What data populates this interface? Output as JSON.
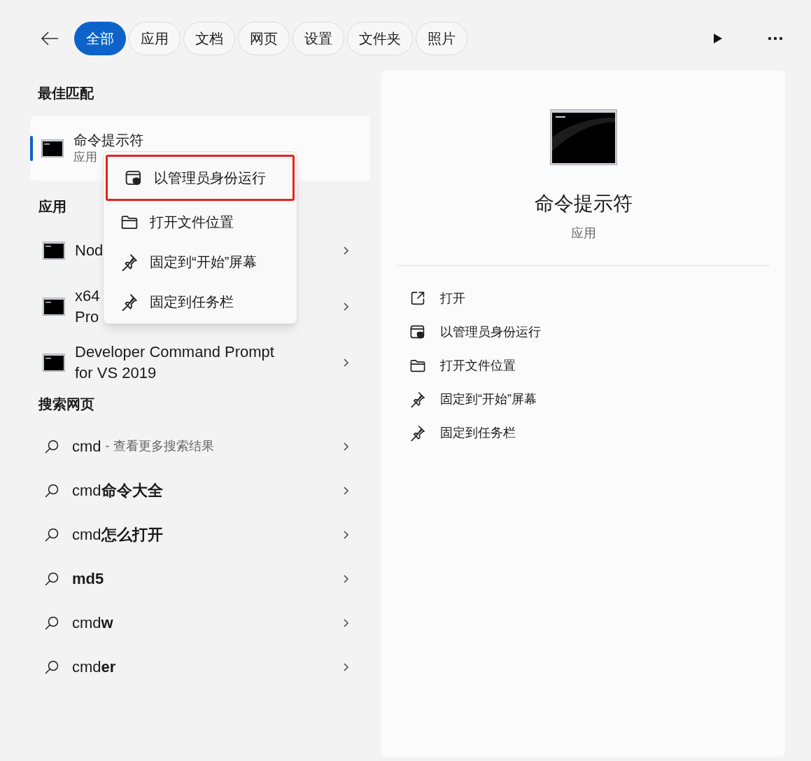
{
  "filter_tabs": [
    {
      "label": "全部",
      "selected": true
    },
    {
      "label": "应用",
      "selected": false
    },
    {
      "label": "文档",
      "selected": false
    },
    {
      "label": "网页",
      "selected": false
    },
    {
      "label": "设置",
      "selected": false
    },
    {
      "label": "文件夹",
      "selected": false
    },
    {
      "label": "照片",
      "selected": false
    }
  ],
  "best_match": {
    "heading": "最佳匹配",
    "title": "命令提示符",
    "subtitle": "应用",
    "selected": true
  },
  "context_menu": [
    {
      "label": "以管理员身份运行",
      "kind": "shield",
      "highlighted": true
    },
    {
      "label": "打开文件位置",
      "kind": "folder",
      "highlighted": false
    },
    {
      "label": "固定到“开始”屏幕",
      "kind": "pin",
      "highlighted": false
    },
    {
      "label": "固定到任务栏",
      "kind": "pin",
      "highlighted": false
    }
  ],
  "apps": {
    "heading": "应用",
    "items": [
      {
        "lines": [
          "Nod"
        ]
      },
      {
        "lines": [
          "x64",
          "Pro"
        ]
      },
      {
        "lines": [
          "Developer Command Prompt",
          "for VS 2019"
        ]
      }
    ]
  },
  "web": {
    "heading": "搜索网页",
    "items": [
      {
        "text": "cmd",
        "hint": "- 查看更多搜索结果"
      },
      {
        "text": "cmd**命令大全**"
      },
      {
        "text": "cmd**怎么打开**"
      },
      {
        "text": "**md5**"
      },
      {
        "text": "cmd**w**"
      },
      {
        "text": "cmd**er**"
      }
    ]
  },
  "detail": {
    "title": "命令提示符",
    "subtitle": "应用",
    "actions": [
      {
        "label": "打开",
        "kind": "open"
      },
      {
        "label": "以管理员身份运行",
        "kind": "shield"
      },
      {
        "label": "打开文件位置",
        "kind": "folder"
      },
      {
        "label": "固定到“开始”屏幕",
        "kind": "pin"
      },
      {
        "label": "固定到任务栏",
        "kind": "pin"
      }
    ]
  }
}
